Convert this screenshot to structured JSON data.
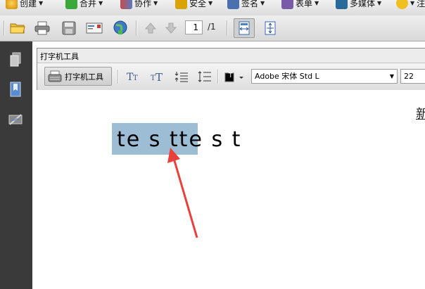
{
  "menubar": {
    "items": [
      {
        "label": "创建",
        "icon": "create-icon",
        "color": "#e0a020"
      },
      {
        "label": "合并",
        "icon": "combine-icon",
        "color": "#3aa83a"
      },
      {
        "label": "协作",
        "icon": "collaborate-icon",
        "color": "#c84a4a"
      },
      {
        "label": "安全",
        "icon": "lock-icon",
        "color": "#d9a400"
      },
      {
        "label": "签名",
        "icon": "sign-pen-icon",
        "color": "#4a70b0"
      },
      {
        "label": "表单",
        "icon": "form-icon",
        "color": "#7a5aa8"
      },
      {
        "label": "多媒体",
        "icon": "multimedia-icon",
        "color": "#2a6a9a"
      },
      {
        "label": "注",
        "icon": "comment-icon",
        "color": "#f0c020"
      }
    ]
  },
  "toolbar": {
    "page_current": "1",
    "page_total": "/1",
    "icons": [
      "open-folder-icon",
      "print-icon",
      "save-icon",
      "email-icon",
      "web-icon",
      "prev-page-icon",
      "next-page-icon",
      "fit-width-icon",
      "fit-page-icon"
    ]
  },
  "leftnav": {
    "icons": [
      "pages-icon",
      "bookmarks-icon",
      "signatures-icon"
    ]
  },
  "typewriter": {
    "title": "打字机工具",
    "tool_label": "打字机工具",
    "font": "Adobe 宋体 Std L",
    "size": "22"
  },
  "document": {
    "typed_text": "te s tte s t",
    "right_char": "新"
  },
  "colors": {
    "selection": "#9dbdd4",
    "arrow": "#e8403a",
    "nav_bg": "#3a3a3a"
  }
}
